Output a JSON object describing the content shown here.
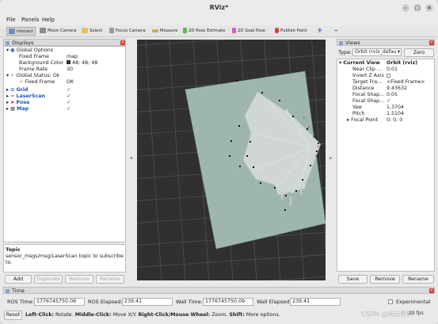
{
  "window": {
    "title": "RViz*"
  },
  "menu": [
    "File",
    "Panels",
    "Help"
  ],
  "toolbar": [
    {
      "label": "Interact",
      "icon": "interact-icon"
    },
    {
      "label": "Move Camera",
      "icon": "move-camera-icon"
    },
    {
      "label": "Select",
      "icon": "select-icon"
    },
    {
      "label": "Focus Camera",
      "icon": "focus-camera-icon"
    },
    {
      "label": "Measure",
      "icon": "measure-icon"
    },
    {
      "label": "2D Pose Estimate",
      "icon": "pose-estimate-icon"
    },
    {
      "label": "2D Goal Pose",
      "icon": "goal-pose-icon"
    },
    {
      "label": "Publish Point",
      "icon": "publish-point-icon"
    }
  ],
  "displays": {
    "title": "Displays",
    "rows": [
      {
        "label": "Global Options",
        "value": ""
      },
      {
        "label": "Fixed Frame",
        "value": "map"
      },
      {
        "label": "Background Color",
        "value": "48; 48; 48"
      },
      {
        "label": "Frame Rate",
        "value": "30"
      },
      {
        "label": "Global Status: Ok",
        "value": ""
      },
      {
        "label": "Fixed Frame",
        "value": "OK"
      },
      {
        "label": "Grid",
        "value": ""
      },
      {
        "label": "LaserScan",
        "value": ""
      },
      {
        "label": "Pose",
        "value": ""
      },
      {
        "label": "Map",
        "value": ""
      }
    ],
    "help_title": "Topic",
    "help_text": "sensor_msgs/msg/LaserScan topic to subscribe to.",
    "buttons": [
      "Add",
      "Duplicate",
      "Remove",
      "Rename"
    ]
  },
  "views": {
    "title": "Views",
    "type_label": "Type:",
    "type_value": "Orbit (rviz_defau",
    "zero_label": "Zero",
    "rows": [
      {
        "label": "Current View",
        "value": "Orbit (rviz)"
      },
      {
        "label": "Near Clip ...",
        "value": "0.01"
      },
      {
        "label": "Invert Z Axis",
        "value": ""
      },
      {
        "label": "Target Fra...",
        "value": "<Fixed Frame>"
      },
      {
        "label": "Distance",
        "value": "9.43632"
      },
      {
        "label": "Focal Shap...",
        "value": "0.05"
      },
      {
        "label": "Focal Shap...",
        "value": "✓"
      },
      {
        "label": "Yaw",
        "value": "1.3704"
      },
      {
        "label": "Pitch",
        "value": "1.5104"
      },
      {
        "label": "Focal Point",
        "value": "0; 0; 0"
      }
    ],
    "buttons": [
      "Save",
      "Remove",
      "Rename"
    ]
  },
  "time": {
    "title": "Time",
    "ros_time_label": "ROS Time:",
    "ros_time": "1776745750.06",
    "ros_elapsed_label": "ROS Elapsed:",
    "ros_elapsed": "239.41",
    "wall_time_label": "Wall Time:",
    "wall_time": "1776745750.09",
    "wall_elapsed_label": "Wall Elapsed:",
    "wall_elapsed": "239.41",
    "experimental": "Experimental"
  },
  "status": {
    "reset": "Reset",
    "hint_left_bold": "Left-Click:",
    "hint_left": "Rotate.",
    "hint_middle_bold": "Middle-Click:",
    "hint_middle": "Move X/Y.",
    "hint_right_bold": "Right-Click/Mouse Wheel:",
    "hint_right": "Zoom.",
    "hint_shift_bold": "Shift:",
    "hint_shift": "More options.",
    "fps": "29 fps",
    "watermark": "CSDN @闲云野鹤"
  },
  "colors": {
    "background": "#303030",
    "map_free": "#9fb6b0",
    "grid": "#5a5a5a"
  }
}
